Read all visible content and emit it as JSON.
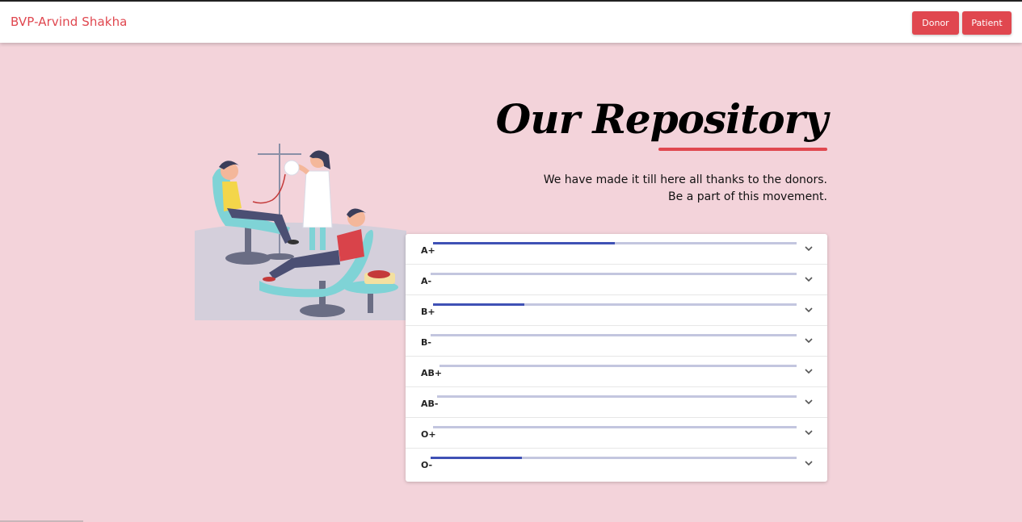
{
  "navbar": {
    "brand": "BVP-Arvind Shakha",
    "donor_label": "Donor",
    "patient_label": "Patient"
  },
  "hero": {
    "title": "Our Repository",
    "tagline_line1": "We have made it till here all thanks to the donors.",
    "tagline_line2": "Be a part of this movement."
  },
  "repository": {
    "groups": [
      {
        "label": "A+",
        "level": 0.5
      },
      {
        "label": "A-",
        "level": 0.0
      },
      {
        "label": "B+",
        "level": 0.25
      },
      {
        "label": "B-",
        "level": 0.0
      },
      {
        "label": "AB+",
        "level": 0.0
      },
      {
        "label": "AB-",
        "level": 0.0
      },
      {
        "label": "O+",
        "level": 0.0
      },
      {
        "label": "O-",
        "level": 0.25
      }
    ]
  },
  "colors": {
    "accent": "#e0474f",
    "background": "#f3d3da",
    "progress_fill": "#3f51b5",
    "progress_track": "#c3c6df"
  },
  "icons": {
    "row_expand": "chevron-down-icon"
  }
}
